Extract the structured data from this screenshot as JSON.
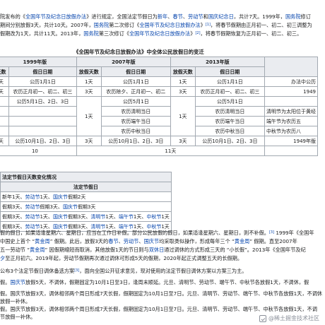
{
  "intro": {
    "l1": [
      "院发布的《",
      "全国年节及纪念日放假办法",
      "》进行规定，全国法定节假日为",
      "新年",
      "、",
      "春节",
      "、",
      "劳动节",
      "和",
      "国庆纪念日",
      "，共计7天。1999年，",
      "国务院",
      "修订"
    ],
    "l2": [
      "期间分别放假3天，共计10天。2007年，",
      "国务院",
      "第二次修订《",
      "全国年节及纪念日放假办法",
      "》",
      "[1]",
      "，将春节假期由正月初一、初二、初三调整为"
    ],
    "l3": [
      "假期改为1天，共计11天。2013年，",
      "国务院",
      "第三次修订《",
      "全国年节及纪念日放假办法",
      "》",
      "[2]",
      "，将春节假期恢复为正月初一、初二、初三。"
    ]
  },
  "table": {
    "caption": "《全国年节及纪念日放假办法》中全体公民放假日的变迁",
    "v1999": "1999年版",
    "v2007": "2007年版",
    "v2013": "2013年版",
    "days": "天数",
    "holiday_date": "假日日期",
    "leave_days": "放假天数",
    "r1": [
      "天",
      "公历1月1日",
      "1天",
      "公历1月1日",
      "1天",
      "公历1月1日",
      "办法中公历"
    ],
    "r2": [
      "天",
      "农历正月初一、初二、初三",
      "3天",
      "农历除夕、正月初一、初二",
      "3天",
      "农历正月初一、初二、初三",
      "1949"
    ],
    "r3": [
      "公历5月1日、2日、3日",
      "公历5月1日",
      "公历5月1日"
    ],
    "r4": [
      "农历清明当日",
      "农历清明当日",
      "清明节为太阳位于黄经"
    ],
    "r5": [
      "农历端午当日",
      "农历端午当日",
      "端午节为农历五"
    ],
    "r6": [
      "农历中秋当日",
      "农历中秋当日",
      "中秋节为农历八"
    ],
    "r7": [
      "天",
      "公历10月1日、2日、3日",
      "3天",
      "公历10月1日、2日、3日",
      "3天",
      "公历10月1日、2日、3日",
      "1949年版"
    ],
    "mid1": "1天",
    "mid2": "1天",
    "tot10": "10",
    "tot11": "11天"
  },
  "subtable": {
    "title": "法定节假日天数变化情况",
    "header": "法定节假日",
    "rows": [
      [
        "新年1天、",
        "劳动节",
        "1天、",
        "国庆节",
        "假期2天"
      ],
      [
        "假期3天、",
        "劳动节",
        "假期3天、",
        "国庆节",
        "假期3天"
      ],
      [
        "假期3天、",
        "劳动节",
        "1天、",
        "国庆节",
        "假期3天、",
        "清明节",
        "1天、",
        "端午节",
        "1天、",
        "中秋节",
        "1天"
      ],
      [
        "假期3天、",
        "劳动节",
        "1天、",
        "国庆节",
        "假期3天、",
        "清明节",
        "1天、",
        "端午节",
        "1天、",
        "中秋节",
        "1天"
      ]
    ]
  },
  "body": {
    "p1": [
      "假的假日，如果适逢星期六、星期日，应当在工作日补假。部分公民放假的假日，如果适逢星期六、星期日，则不补假。",
      "[3]",
      " 1999年《全国年"
    ],
    "p2": [
      "中国史上首个 “",
      "黄金周",
      "” 假期。此后，放假3天的",
      "春节",
      "、",
      "劳动节",
      "、",
      "国庆节",
      "均采取类似操作，形成每年三个 “",
      "黄金周",
      "” 假期。直至2007年"
    ],
    "p3": [
      "五一劳动节 “",
      "黄金周",
      "” 因假期缩短而取消，其他放假1天的节日则与",
      "双休日",
      "通过调休的方式形成三天的 “小长假”。2013年《全国年节及纪"
    ],
    "p4": [
      "夕",
      "至正月初六。2019年起，劳动节假期再次通过调休可形成5天的假期，2020年起正式调整五天的长假期。"
    ],
    "p5": [
      "公布3个法定节假日调休备选方案",
      "[3]",
      "，面向全国公开征求意见，现对使用的法定节假日调休方案以方案三为主。"
    ],
    "p6": [
      "假。",
      "国庆节",
      "放假5天，不调休，假期固定为10月1日至3日，逢周末顺延。元旦、清明节、劳动节、端午节、中秋节各放假1天，不调休，假"
    ],
    "p7": [
      "假。国庆节放假3天，调休相邻两个周日形成7天长假，假期固定为10月1日至7日。元旦、清明节、劳动节、端午节、中秋节各放假1天，不调休"
    ],
    "p8": [
      "放假一补休。"
    ],
    "p9": [
      "假。国庆节放假3天，调休相邻两个周日形成7天长假，假期固定为10月1日至7日。元旦、清明节、劳动节、端午节、中秋节各放假1天，不调"
    ],
    "p10": [
      "节放假一补休。"
    ]
  },
  "watermark": "@稀土掘金技术社区"
}
